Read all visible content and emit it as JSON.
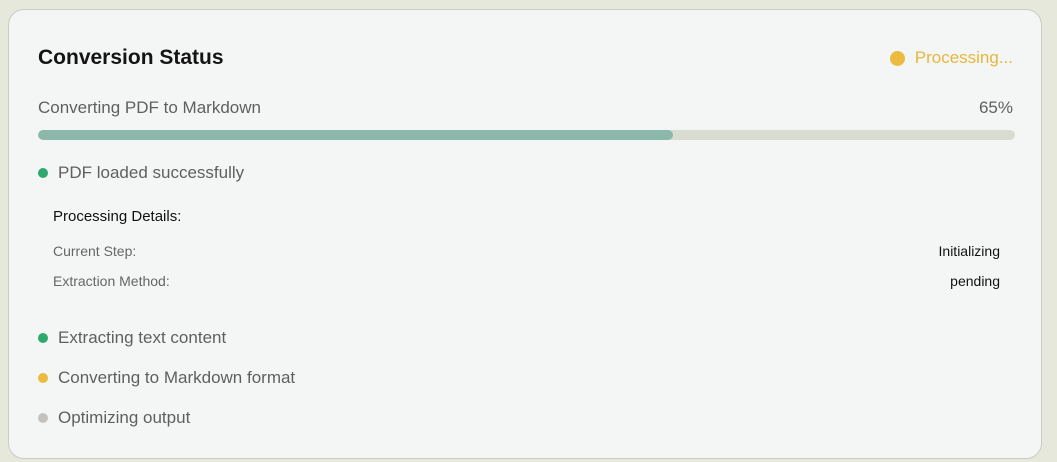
{
  "card": {
    "title": "Conversion Status",
    "status": {
      "label": "Processing...",
      "color": "#ebba3f"
    }
  },
  "progress": {
    "label": "Converting PDF to Markdown",
    "percent_text": "65%",
    "value": 0.65,
    "fill_color": "#8cb7ab",
    "track_color": "#d8dcd1"
  },
  "steps": [
    {
      "label": "PDF loaded successfully",
      "state": "done",
      "color": "#2ea86d"
    },
    {
      "label": "Extracting text content",
      "state": "done",
      "color": "#2ea86d"
    },
    {
      "label": "Converting to Markdown format",
      "state": "active",
      "color": "#ebba3f"
    },
    {
      "label": "Optimizing output",
      "state": "pending",
      "color": "#c4c2bd"
    }
  ],
  "details": {
    "title": "Processing Details:",
    "rows": [
      {
        "label": "Current Step:",
        "value": "Initializing"
      },
      {
        "label": "Extraction Method:",
        "value": "pending"
      }
    ]
  }
}
